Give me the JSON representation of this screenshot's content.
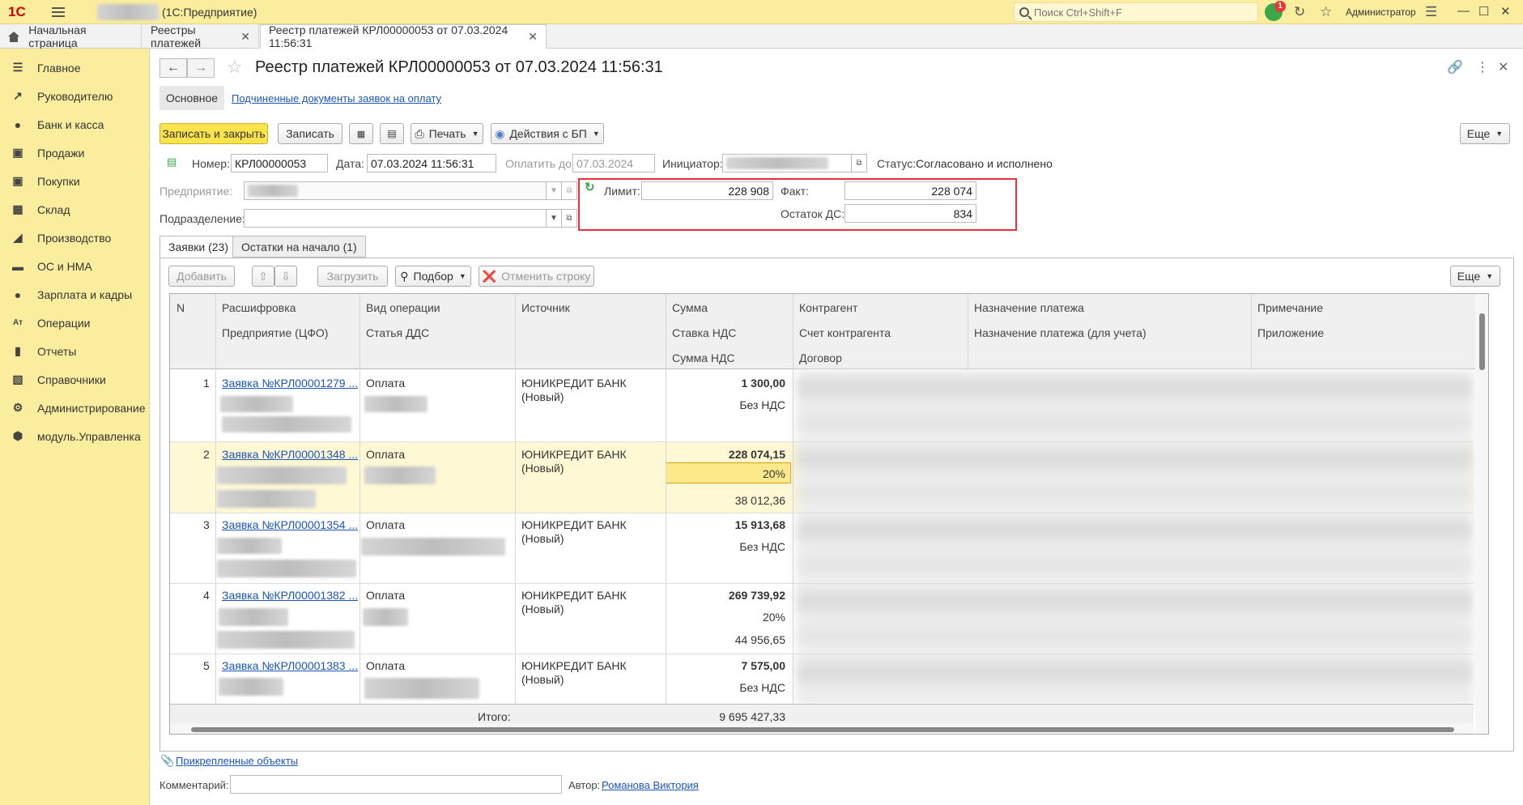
{
  "topbar": {
    "app_title": "(1С:Предприятие)",
    "search_placeholder": "Поиск Ctrl+Shift+F",
    "notification_count": "1",
    "user": "Администратор"
  },
  "tabs": [
    {
      "label": "Начальная страница"
    },
    {
      "label": "Реестры платежей"
    },
    {
      "label": "Реестр платежей КРЛ00000053 от 07.03.2024 11:56:31"
    }
  ],
  "sidebar": {
    "items": [
      {
        "label": "Главное",
        "icon": "menu-icon"
      },
      {
        "label": "Руководителю",
        "icon": "trend-icon"
      },
      {
        "label": "Банк и касса",
        "icon": "coin-icon"
      },
      {
        "label": "Продажи",
        "icon": "bag-icon"
      },
      {
        "label": "Покупки",
        "icon": "cart-icon"
      },
      {
        "label": "Склад",
        "icon": "grid-icon"
      },
      {
        "label": "Производство",
        "icon": "factory-icon"
      },
      {
        "label": "ОС и НМА",
        "icon": "truck-icon"
      },
      {
        "label": "Зарплата и кадры",
        "icon": "person-icon"
      },
      {
        "label": "Операции",
        "icon": "ops-icon"
      },
      {
        "label": "Отчеты",
        "icon": "chart-icon"
      },
      {
        "label": "Справочники",
        "icon": "book-icon"
      },
      {
        "label": "Администрирование",
        "icon": "gear-icon"
      },
      {
        "label": "модуль.Управленка",
        "icon": "box-icon"
      }
    ]
  },
  "doc": {
    "title": "Реестр платежей КРЛ00000053 от 07.03.2024 11:56:31",
    "subtab_main": "Основное",
    "subtab_link": "Подчиненные документы заявок на оплату"
  },
  "toolbar": {
    "save_close": "Записать и закрыть",
    "save": "Записать",
    "print": "Печать",
    "actions": "Действия с БП",
    "more": "Еще"
  },
  "header": {
    "number_label": "Номер:",
    "number": "КРЛ00000053",
    "date_label": "Дата:",
    "date": "07.03.2024 11:56:31",
    "pay_until_label": "Оплатить до:",
    "pay_until": "07.03.2024",
    "initiator_label": "Инициатор:",
    "status_label": "Статус:",
    "status": "Согласовано и исполнено",
    "enterprise_label": "Предприятие:",
    "department_label": "Подразделение:",
    "limit_label": "Лимит:",
    "limit": "228 908",
    "fact_label": "Факт:",
    "fact": "228 074",
    "remainder_label": "Остаток ДС:",
    "remainder": "834"
  },
  "inner_tabs": [
    {
      "label": "Заявки (23)"
    },
    {
      "label": "Остатки на начало (1)"
    }
  ],
  "table_toolbar": {
    "add": "Добавить",
    "load": "Загрузить",
    "select": "Подбор",
    "cancel_row": "Отменить строку",
    "more": "Еще"
  },
  "table": {
    "headers": {
      "n": "N",
      "decoding": "Расшифровка",
      "enterprise": "Предприятие (ЦФО)",
      "op_type": "Вид операции",
      "dds": "Статья ДДС",
      "source": "Источник",
      "sum": "Сумма",
      "vat_rate": "Ставка НДС",
      "vat_sum": "Сумма НДС",
      "counterparty": "Контрагент",
      "cp_account": "Счет контрагента",
      "contract": "Договор",
      "purpose": "Назначение платежа",
      "purpose_acc": "Назначение платежа (для учета)",
      "note": "Примечание",
      "attachment": "Приложение"
    },
    "rows": [
      {
        "n": "1",
        "link": "Заявка №КРЛ00001279 ...",
        "op": "Оплата",
        "source1": "ЮНИКРЕДИТ БАНК",
        "source2": "(Новый)",
        "sum": "1 300,00",
        "vat": "Без НДС",
        "vat_sum": ""
      },
      {
        "n": "2",
        "link": "Заявка №КРЛ00001348 ...",
        "op": "Оплата",
        "source1": "ЮНИКРЕДИТ БАНК",
        "source2": "(Новый)",
        "sum": "228 074,15",
        "vat": "20%",
        "vat_sum": "38 012,36"
      },
      {
        "n": "3",
        "link": "Заявка №КРЛ00001354 ...",
        "op": "Оплата",
        "source1": "ЮНИКРЕДИТ БАНК",
        "source2": "(Новый)",
        "sum": "15 913,68",
        "vat": "Без НДС",
        "vat_sum": ""
      },
      {
        "n": "4",
        "link": "Заявка №КРЛ00001382 ...",
        "op": "Оплата",
        "source1": "ЮНИКРЕДИТ БАНК",
        "source2": "(Новый)",
        "sum": "269 739,92",
        "vat": "20%",
        "vat_sum": "44 956,65"
      },
      {
        "n": "5",
        "link": "Заявка №КРЛ00001383 ...",
        "op": "Оплата",
        "source1": "ЮНИКРЕДИТ БАНК",
        "source2": "(Новый)",
        "sum": "7 575,00",
        "vat": "Без НДС",
        "vat_sum": ""
      }
    ],
    "total_label": "Итого:",
    "total": "9 695 427,33"
  },
  "footer": {
    "attached": "Прикрепленные объекты",
    "comment_label": "Комментарий:",
    "author_label": "Автор:",
    "author": "Романова Виктория"
  }
}
